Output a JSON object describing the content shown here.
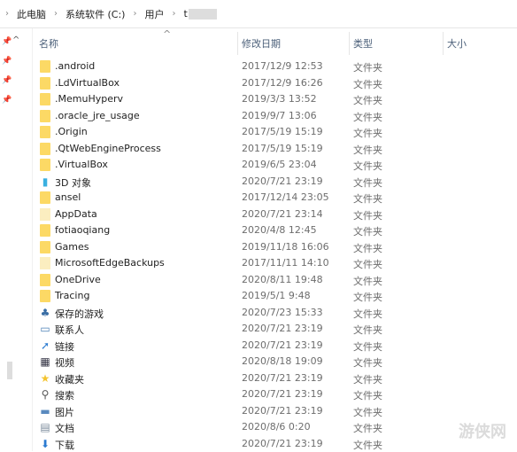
{
  "breadcrumb": [
    "此电脑",
    "系统软件 (C:)",
    "用户",
    "t"
  ],
  "columns": {
    "name": "名称",
    "date": "修改日期",
    "type": "类型",
    "size": "大小"
  },
  "files": [
    {
      "name": ".android",
      "date": "2017/12/9 12:53",
      "type": "文件夹",
      "icon": "folder"
    },
    {
      "name": ".LdVirtualBox",
      "date": "2017/12/9 16:26",
      "type": "文件夹",
      "icon": "folder"
    },
    {
      "name": ".MemuHyperv",
      "date": "2019/3/3 13:52",
      "type": "文件夹",
      "icon": "folder"
    },
    {
      "name": ".oracle_jre_usage",
      "date": "2019/9/7 13:06",
      "type": "文件夹",
      "icon": "folder"
    },
    {
      "name": ".Origin",
      "date": "2017/5/19 15:19",
      "type": "文件夹",
      "icon": "folder"
    },
    {
      "name": ".QtWebEngineProcess",
      "date": "2017/5/19 15:19",
      "type": "文件夹",
      "icon": "folder"
    },
    {
      "name": ".VirtualBox",
      "date": "2019/6/5 23:04",
      "type": "文件夹",
      "icon": "folder"
    },
    {
      "name": "3D 对象",
      "date": "2020/7/21 23:19",
      "type": "文件夹",
      "icon": "3d-objects"
    },
    {
      "name": "ansel",
      "date": "2017/12/14 23:05",
      "type": "文件夹",
      "icon": "folder"
    },
    {
      "name": "AppData",
      "date": "2020/7/21 23:14",
      "type": "文件夹",
      "icon": "folder-hidden"
    },
    {
      "name": "fotiaoqiang",
      "date": "2020/4/8 12:45",
      "type": "文件夹",
      "icon": "folder"
    },
    {
      "name": "Games",
      "date": "2019/11/18 16:06",
      "type": "文件夹",
      "icon": "folder"
    },
    {
      "name": "MicrosoftEdgeBackups",
      "date": "2017/11/11 14:10",
      "type": "文件夹",
      "icon": "folder-hidden"
    },
    {
      "name": "OneDrive",
      "date": "2020/8/11 19:48",
      "type": "文件夹",
      "icon": "folder"
    },
    {
      "name": "Tracing",
      "date": "2019/5/1 9:48",
      "type": "文件夹",
      "icon": "folder"
    },
    {
      "name": "保存的游戏",
      "date": "2020/7/23 15:33",
      "type": "文件夹",
      "icon": "saved-games"
    },
    {
      "name": "联系人",
      "date": "2020/7/21 23:19",
      "type": "文件夹",
      "icon": "contacts"
    },
    {
      "name": "链接",
      "date": "2020/7/21 23:19",
      "type": "文件夹",
      "icon": "links"
    },
    {
      "name": "视频",
      "date": "2020/8/18 19:09",
      "type": "文件夹",
      "icon": "videos"
    },
    {
      "name": "收藏夹",
      "date": "2020/7/21 23:19",
      "type": "文件夹",
      "icon": "favorites"
    },
    {
      "name": "搜索",
      "date": "2020/7/21 23:19",
      "type": "文件夹",
      "icon": "search"
    },
    {
      "name": "图片",
      "date": "2020/7/21 23:19",
      "type": "文件夹",
      "icon": "pictures"
    },
    {
      "name": "文档",
      "date": "2020/8/6 0:20",
      "type": "文件夹",
      "icon": "documents"
    },
    {
      "name": "下载",
      "date": "2020/7/21 23:19",
      "type": "文件夹",
      "icon": "downloads"
    }
  ],
  "watermark": "游侠网"
}
